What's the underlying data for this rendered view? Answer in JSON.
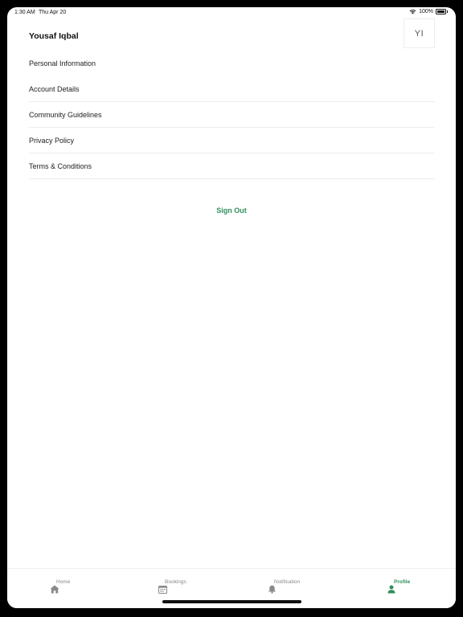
{
  "status_bar": {
    "time": "1:30 AM",
    "date": "Thu Apr 20",
    "battery": "100%",
    "wifi_icon": "wifi-icon",
    "battery_icon": "battery-icon"
  },
  "profile": {
    "name": "Yousaf Iqbal",
    "initials": "YI"
  },
  "menu": {
    "items": [
      {
        "label": "Personal Information"
      },
      {
        "label": "Account Details"
      },
      {
        "label": "Community Guidelines"
      },
      {
        "label": "Privacy Policy"
      },
      {
        "label": "Terms & Conditions"
      }
    ]
  },
  "actions": {
    "sign_out": "Sign Out"
  },
  "tab_bar": {
    "tabs": [
      {
        "label": "Home",
        "icon": "home-icon"
      },
      {
        "label": "Bookings",
        "icon": "calendar-icon"
      },
      {
        "label": "Notification",
        "icon": "bell-icon"
      },
      {
        "label": "Profile",
        "icon": "person-icon",
        "active": true
      }
    ]
  },
  "colors": {
    "accent": "#2f8f5b",
    "inactive": "#888888",
    "divider": "#ececec"
  }
}
